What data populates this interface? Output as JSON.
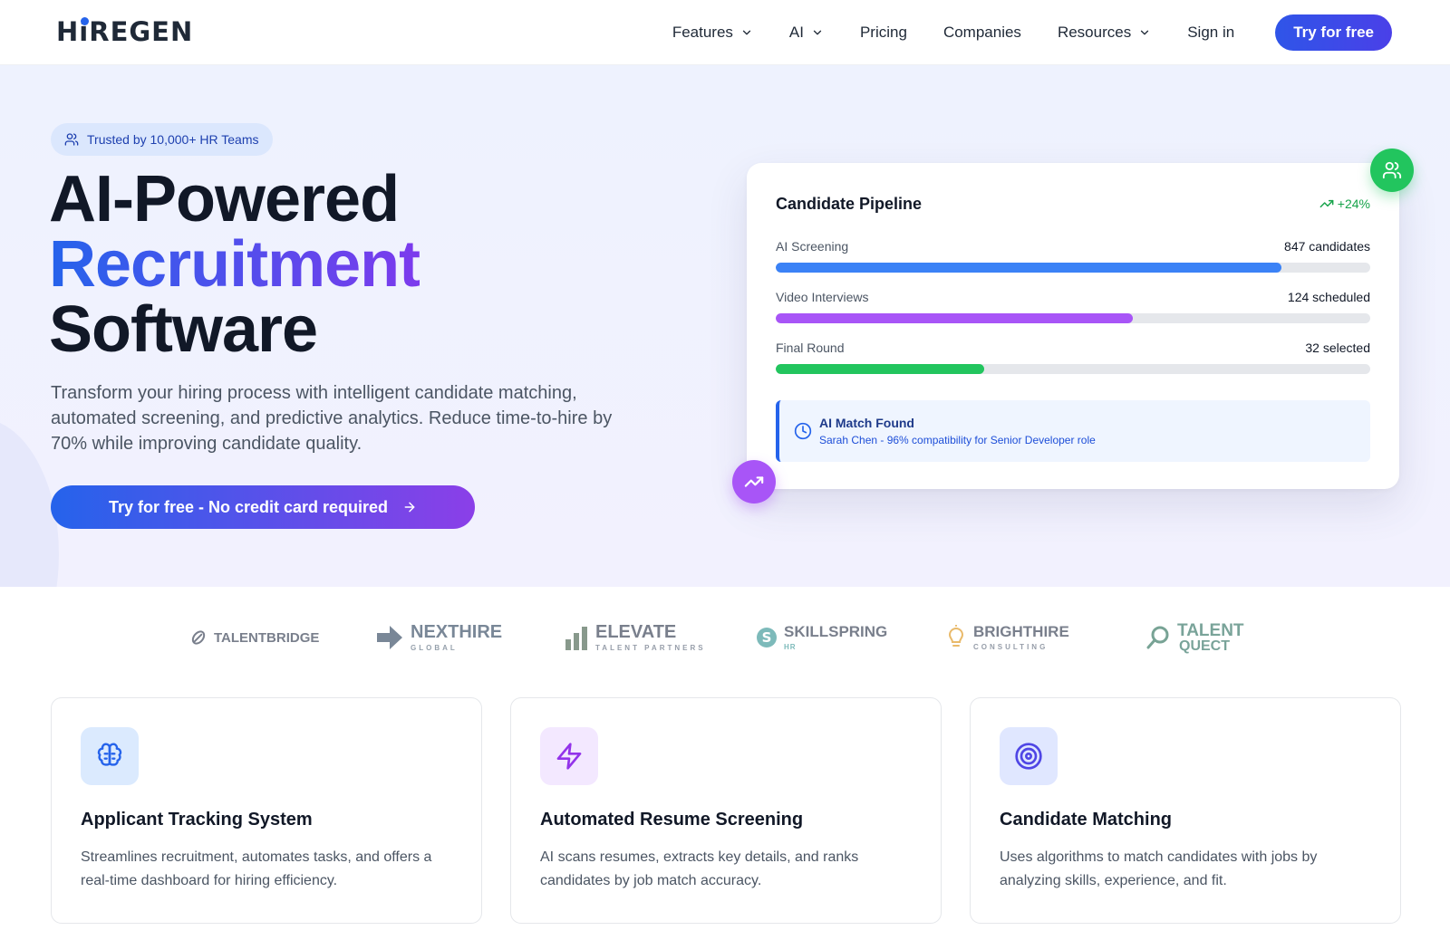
{
  "nav": {
    "logo_text": "HIREGEN",
    "items": [
      {
        "label": "Features",
        "has_dropdown": true
      },
      {
        "label": "AI",
        "has_dropdown": true
      },
      {
        "label": "Pricing",
        "has_dropdown": false
      },
      {
        "label": "Companies",
        "has_dropdown": false
      },
      {
        "label": "Resources",
        "has_dropdown": true
      },
      {
        "label": "Sign in",
        "has_dropdown": false
      }
    ],
    "cta_label": "Try for free"
  },
  "hero": {
    "badge_text": "Trusted by 10,000+ HR Teams",
    "headline_line1": "AI-Powered",
    "headline_line2": "Recruitment",
    "headline_line3": "Software",
    "subtext": "Transform your hiring process with intelligent candidate matching, automated screening, and predictive analytics. Reduce time-to-hire by 70% while improving candidate quality.",
    "cta_label": "Try for free - No credit card required"
  },
  "pipeline": {
    "title": "Candidate Pipeline",
    "trend": "+24%",
    "stages": [
      {
        "label": "AI Screening",
        "value": "847 candidates",
        "fill_fraction": 0.85,
        "color": "#3b82f6"
      },
      {
        "label": "Video Interviews",
        "value": "124 scheduled",
        "fill_fraction": 0.6,
        "color": "#a855f7"
      },
      {
        "label": "Final Round",
        "value": "32 selected",
        "fill_fraction": 0.35,
        "color": "#22c55e"
      }
    ],
    "match_title": "AI Match Found",
    "match_detail": "Sarah Chen - 96% compatibility for Senior Developer role"
  },
  "logos": [
    {
      "name": "TALENTBRIDGE",
      "sub": ""
    },
    {
      "name": "NEXTHIRE",
      "sub": "GLOBAL"
    },
    {
      "name": "ELEVATE",
      "sub": "TALENT PARTNERS"
    },
    {
      "name": "SKILLSPRING",
      "sub": "HR"
    },
    {
      "name": "BRIGHTHIRE",
      "sub": "CONSULTING"
    },
    {
      "name": "TALENT",
      "sub": "QUECT"
    }
  ],
  "features": [
    {
      "title": "Applicant Tracking System",
      "desc": "Streamlines recruitment, automates tasks, and offers a real-time dashboard for hiring efficiency.",
      "icon": "brain-icon",
      "icon_bg": "#dbeafe",
      "icon_color": "#2563eb"
    },
    {
      "title": "Automated Resume Screening",
      "desc": "AI scans resumes, extracts key details, and ranks candidates by job match accuracy.",
      "icon": "lightning-icon",
      "icon_bg": "#f3e8ff",
      "icon_color": "#9333ea"
    },
    {
      "title": "Candidate Matching",
      "desc": "Uses algorithms to match candidates with jobs by analyzing skills, experience, and fit.",
      "icon": "target-icon",
      "icon_bg": "#e0e7ff",
      "icon_color": "#4f46e5"
    }
  ],
  "colors": {
    "brand_blue": "#2563eb",
    "brand_purple": "#7c3aed",
    "success_green": "#22c55e"
  }
}
